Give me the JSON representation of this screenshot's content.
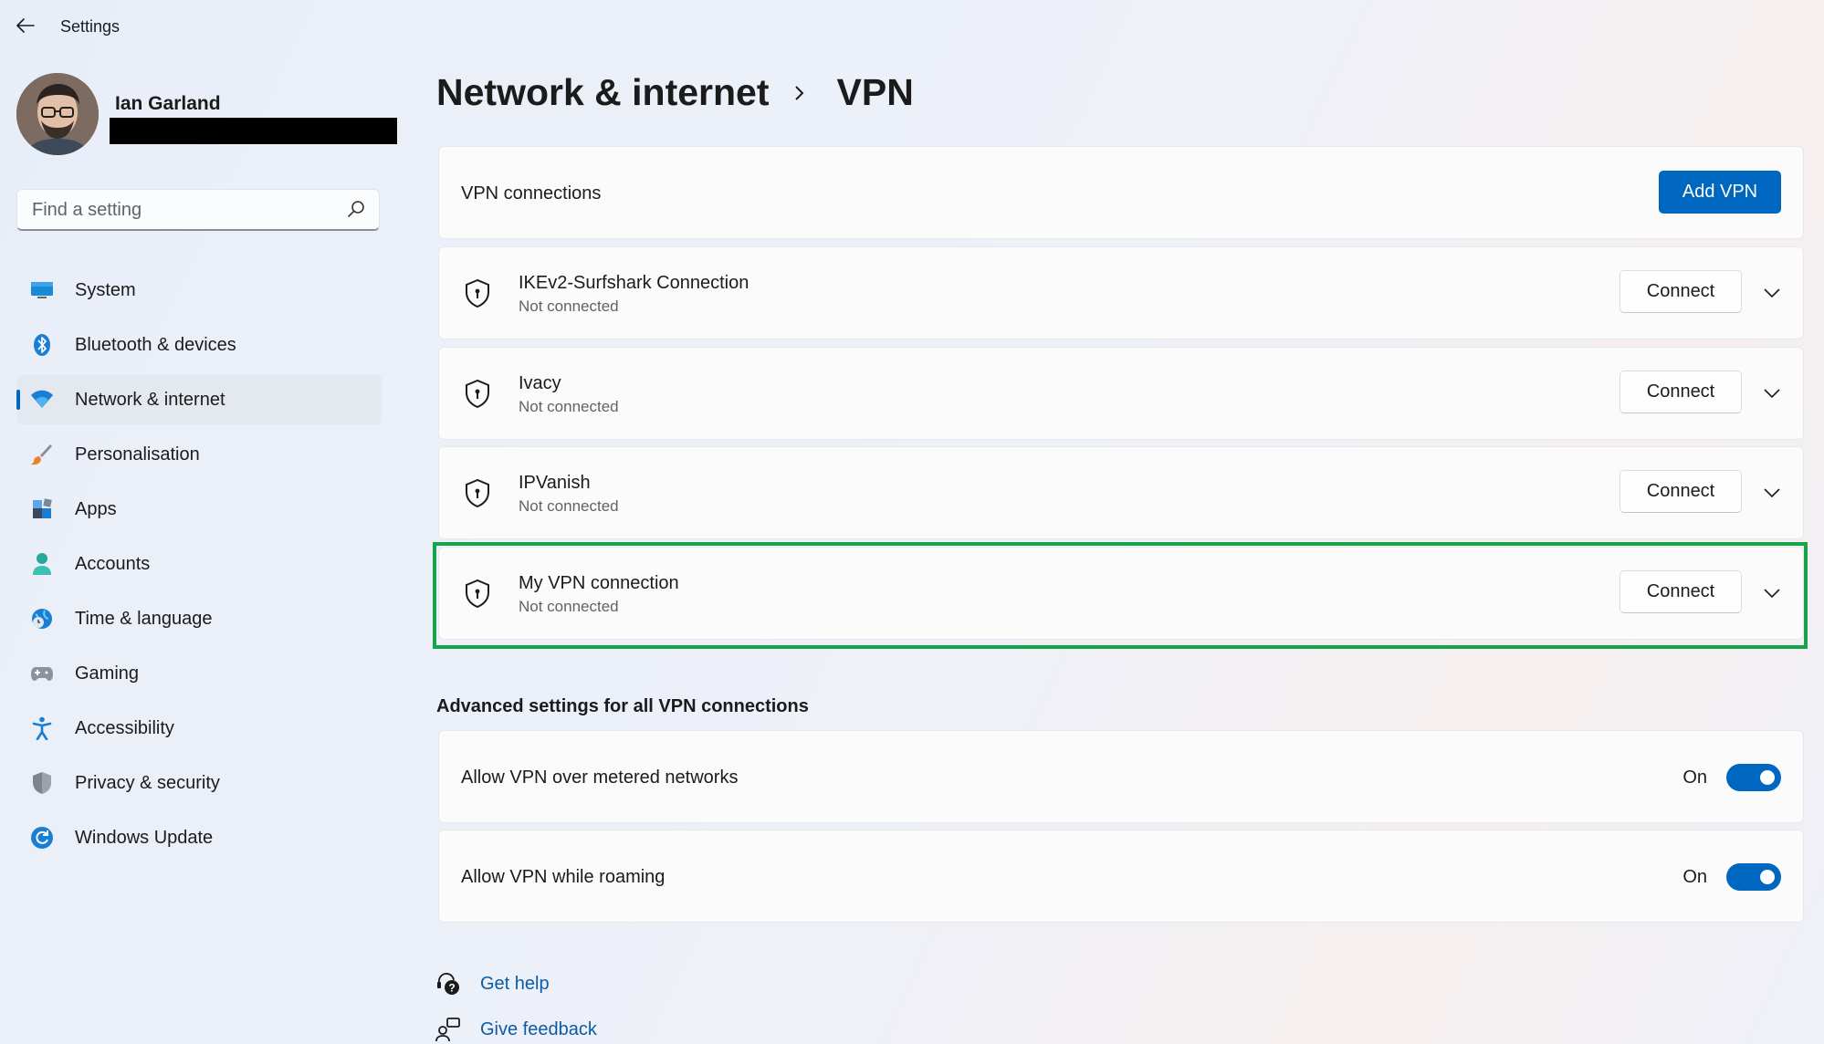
{
  "app": {
    "title": "Settings"
  },
  "profile": {
    "name": "Ian Garland"
  },
  "search": {
    "placeholder": "Find a setting"
  },
  "nav": {
    "items": [
      {
        "label": "System",
        "icon": "monitor-icon"
      },
      {
        "label": "Bluetooth & devices",
        "icon": "bluetooth-icon"
      },
      {
        "label": "Network & internet",
        "icon": "wifi-icon",
        "active": true
      },
      {
        "label": "Personalisation",
        "icon": "brush-icon"
      },
      {
        "label": "Apps",
        "icon": "apps-icon"
      },
      {
        "label": "Accounts",
        "icon": "person-icon"
      },
      {
        "label": "Time & language",
        "icon": "globe-clock-icon"
      },
      {
        "label": "Gaming",
        "icon": "gamepad-icon"
      },
      {
        "label": "Accessibility",
        "icon": "accessibility-icon"
      },
      {
        "label": "Privacy & security",
        "icon": "shield-icon"
      },
      {
        "label": "Windows Update",
        "icon": "update-icon"
      }
    ]
  },
  "breadcrumb": {
    "parent": "Network & internet",
    "current": "VPN"
  },
  "vpn": {
    "section_label": "VPN connections",
    "add_button": "Add VPN",
    "connections": [
      {
        "name": "IKEv2-Surfshark Connection",
        "status": "Not connected",
        "action": "Connect"
      },
      {
        "name": "Ivacy",
        "status": "Not connected",
        "action": "Connect"
      },
      {
        "name": "IPVanish",
        "status": "Not connected",
        "action": "Connect"
      },
      {
        "name": "My VPN connection",
        "status": "Not connected",
        "action": "Connect"
      }
    ]
  },
  "advanced": {
    "heading": "Advanced settings for all VPN connections",
    "settings": [
      {
        "label": "Allow VPN over metered networks",
        "state": "On",
        "enabled": true
      },
      {
        "label": "Allow VPN while roaming",
        "state": "On",
        "enabled": true
      }
    ]
  },
  "links": {
    "help": "Get help",
    "feedback": "Give feedback"
  },
  "colors": {
    "accent": "#0067c0",
    "highlight": "#17a34a"
  }
}
